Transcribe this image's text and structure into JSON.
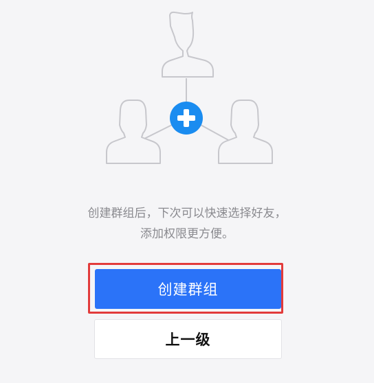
{
  "illustration": {
    "icons": [
      "person-icon",
      "person-icon",
      "person-icon",
      "plus-circle-icon"
    ],
    "colors": {
      "outline": "#c7c7cc",
      "accent": "#1a8cf0"
    }
  },
  "description": {
    "line1": "创建群组后，下次可以快速选择好友，",
    "line2": "添加权限更方便。"
  },
  "buttons": {
    "create_group_label": "创建群组",
    "back_label": "上一级"
  },
  "colors": {
    "primary": "#2b73f8",
    "highlight_border": "#e23b3b",
    "background": "#f5f5f7"
  }
}
